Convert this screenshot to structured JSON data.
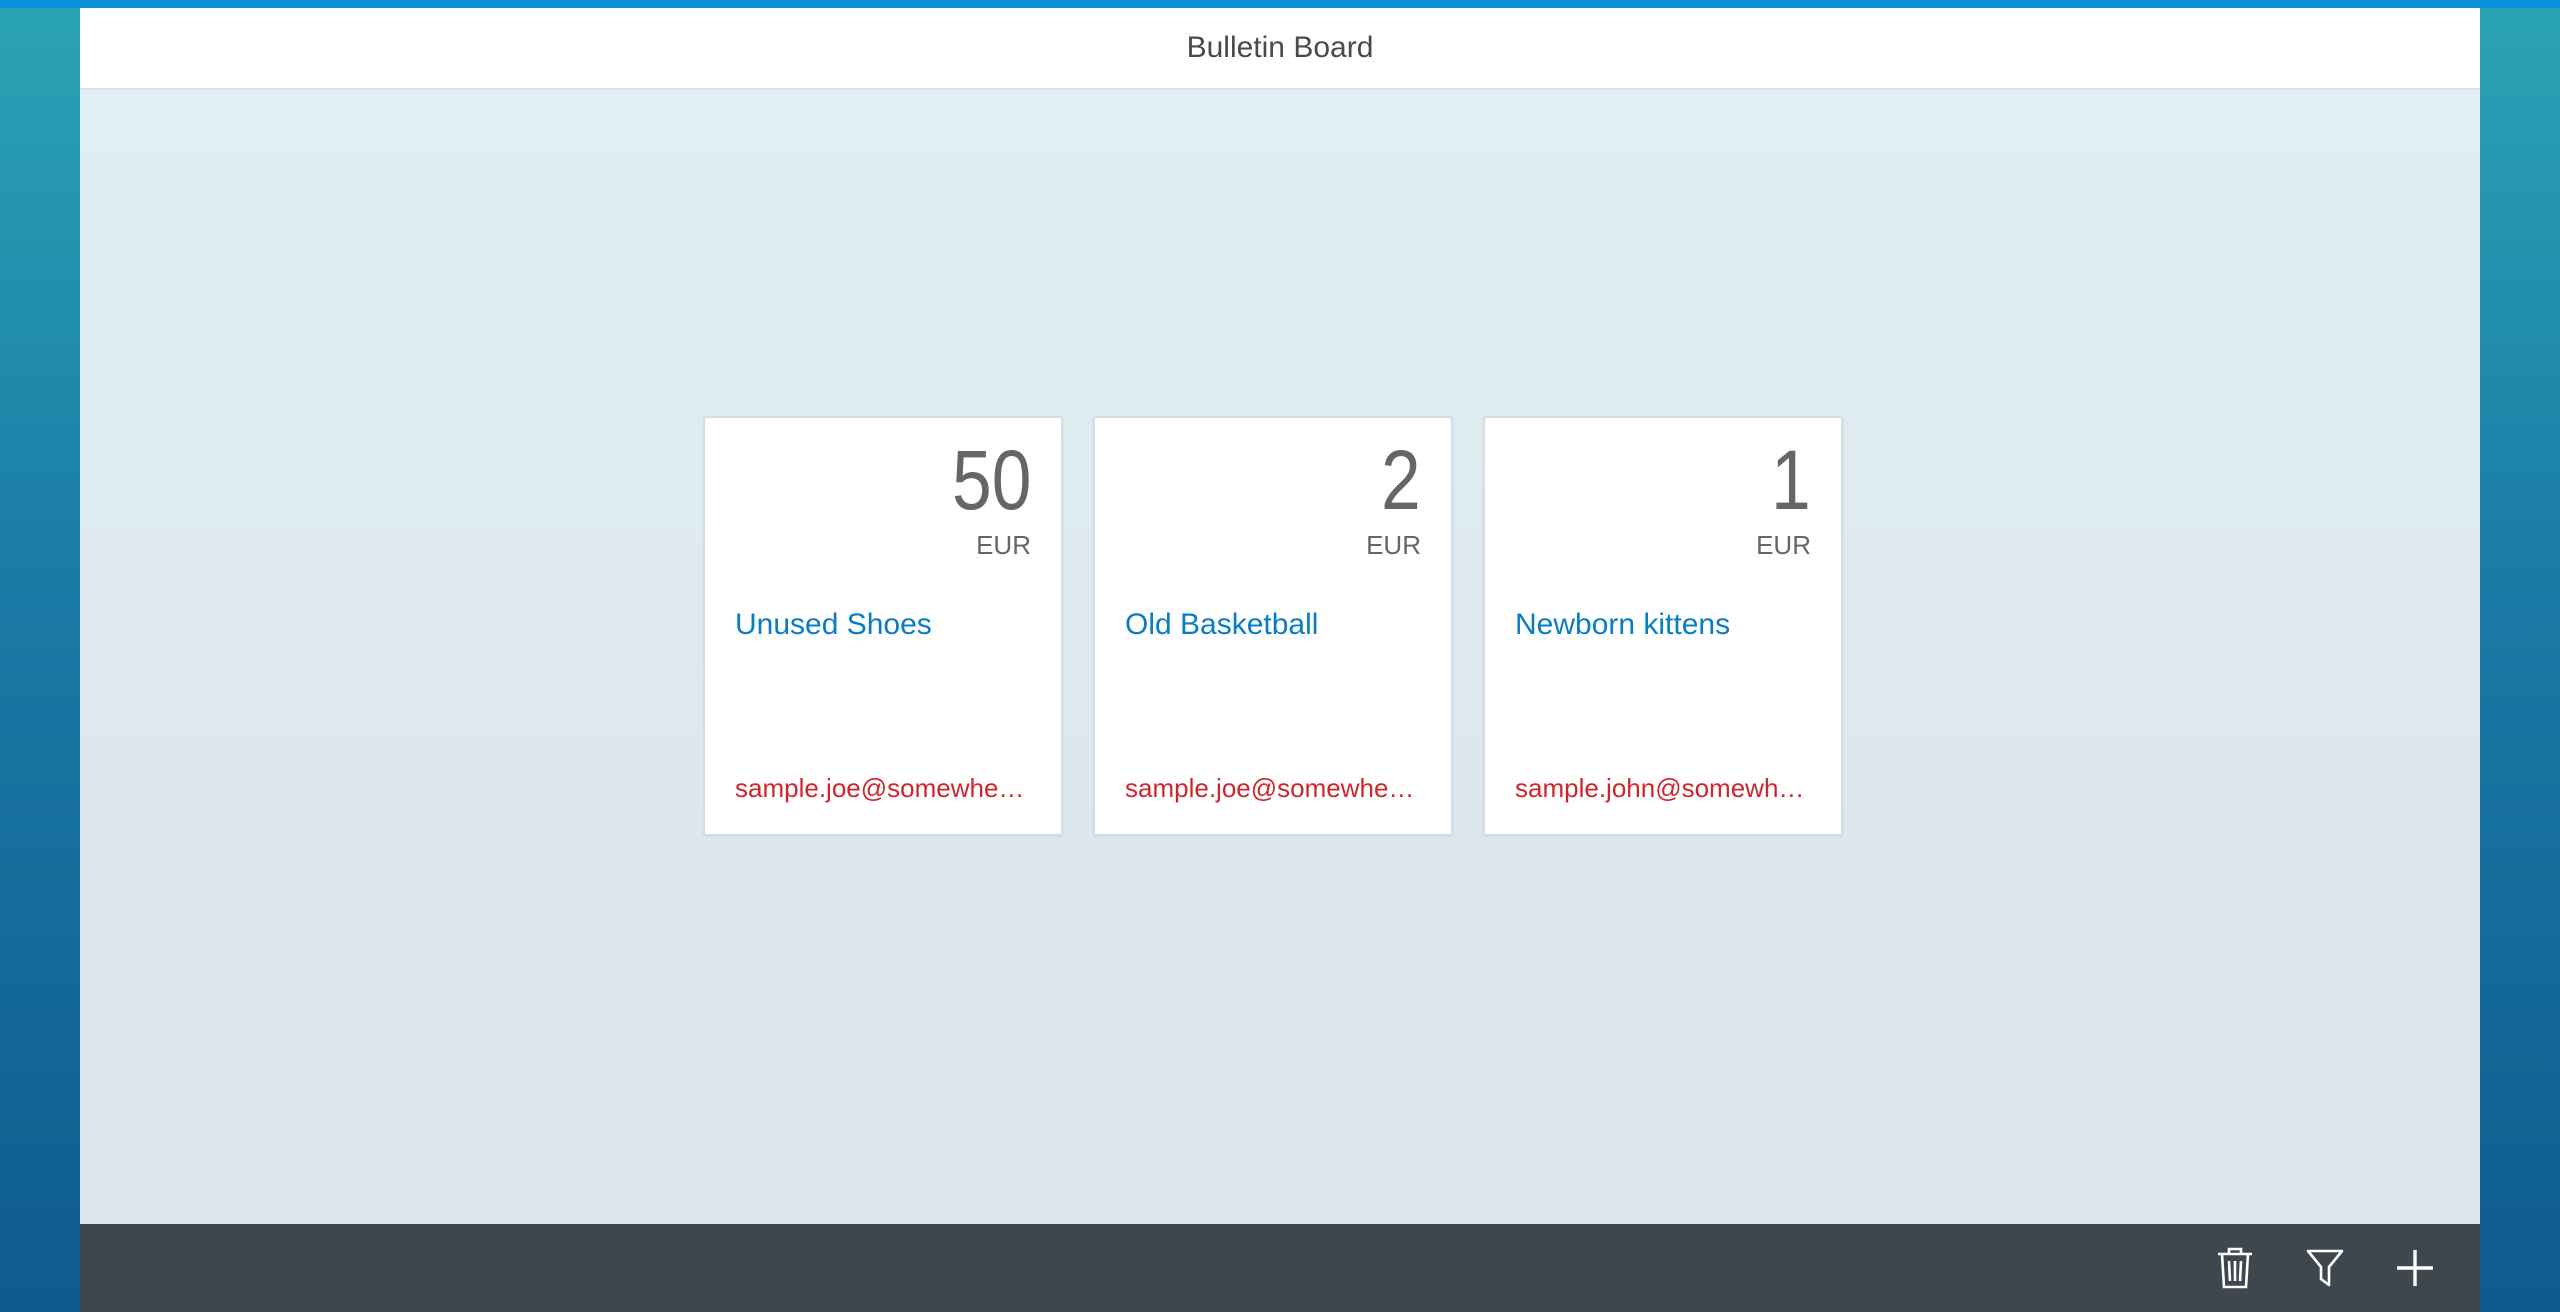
{
  "header": {
    "title": "Bulletin Board"
  },
  "tiles": [
    {
      "value": "50",
      "unit": "EUR",
      "name": "Unused Shoes",
      "contact": "sample.joe@somewhere.com"
    },
    {
      "value": "2",
      "unit": "EUR",
      "name": "Old Basketball",
      "contact": "sample.joe@somewhere.com"
    },
    {
      "value": "1",
      "unit": "EUR",
      "name": "Newborn kittens",
      "contact": "sample.john@somewhere.com"
    }
  ],
  "footer": {
    "icons": [
      "trash-icon",
      "filter-icon",
      "add-icon"
    ]
  },
  "colors": {
    "accent": "#0a8fd8",
    "link": "#0a7cc4",
    "contact": "#d0252b",
    "footer_bg": "#3f474e"
  }
}
